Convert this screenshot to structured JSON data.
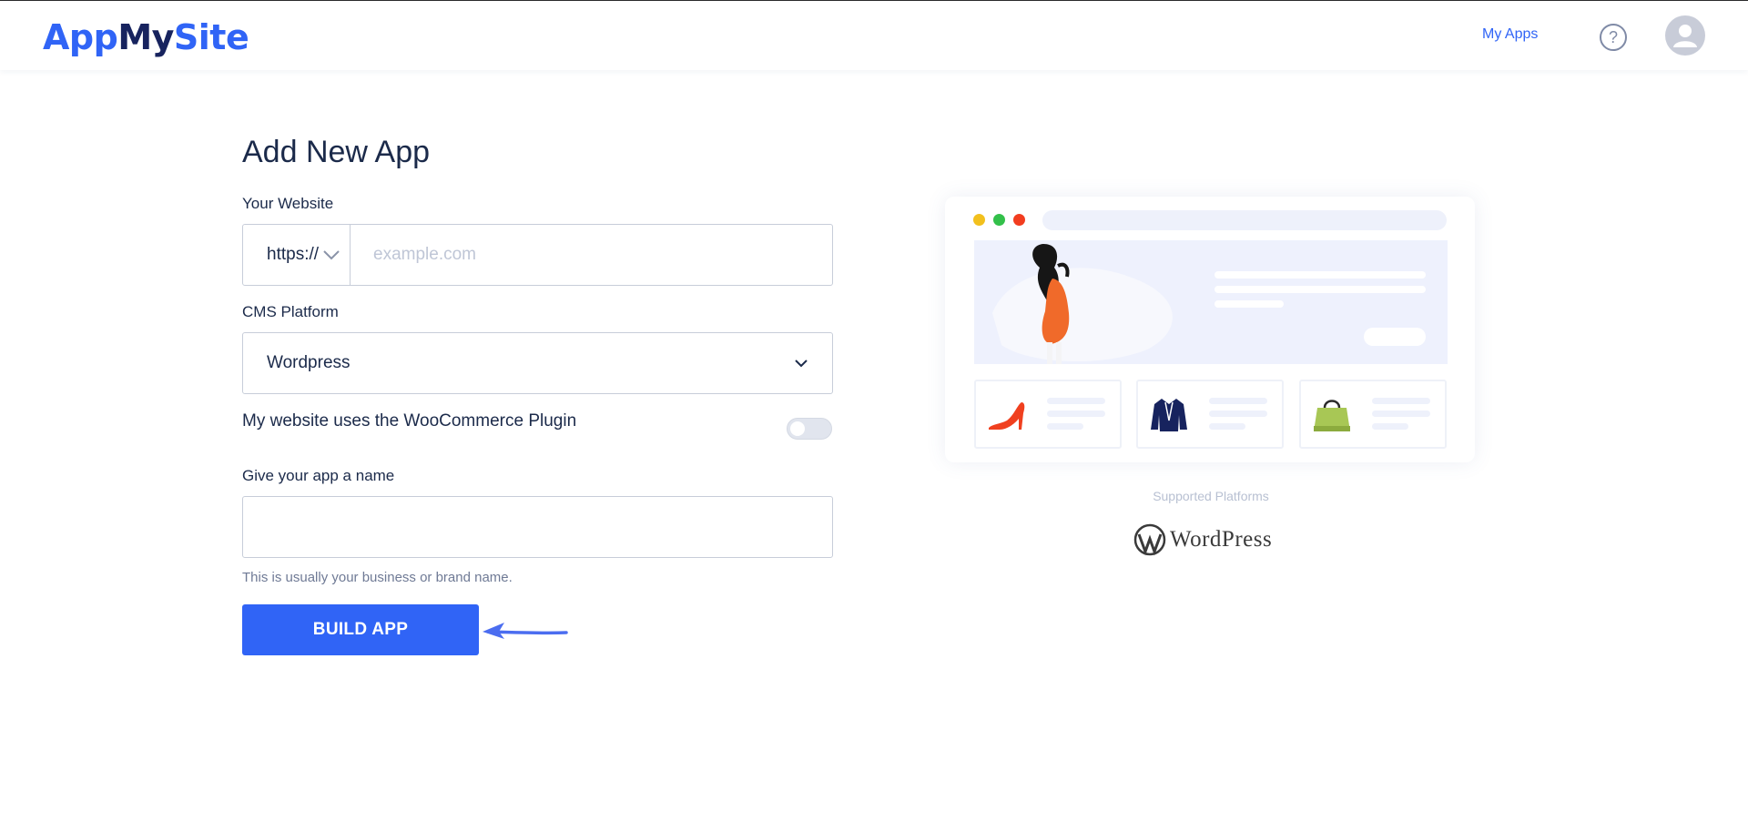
{
  "header": {
    "logo": {
      "part1": "App",
      "part2": "My",
      "part3": "Site"
    },
    "nav_my_apps": "My Apps",
    "help_icon": "help-circle-icon",
    "avatar_icon": "user-icon"
  },
  "form": {
    "title": "Add New App",
    "website_label": "Your Website",
    "protocol_value": "https://",
    "website_placeholder": "example.com",
    "website_value": "",
    "cms_label": "CMS Platform",
    "cms_value": "Wordpress",
    "woo_label": "My website uses the WooCommerce Plugin",
    "woo_enabled": false,
    "name_label": "Give your app a name",
    "name_value": "",
    "name_hint": "This is usually your business or brand name.",
    "build_button": "BUILD APP"
  },
  "preview": {
    "supported_label": "Supported Platforms",
    "platform_name": "WordPress",
    "window_dot_colors": [
      "#f2c01d",
      "#33c04a",
      "#f23d1f"
    ],
    "product_icons": [
      "high-heel-icon",
      "jacket-icon",
      "shopping-bag-icon"
    ]
  },
  "colors": {
    "accent": "#3064f6",
    "navy": "#17235e"
  }
}
